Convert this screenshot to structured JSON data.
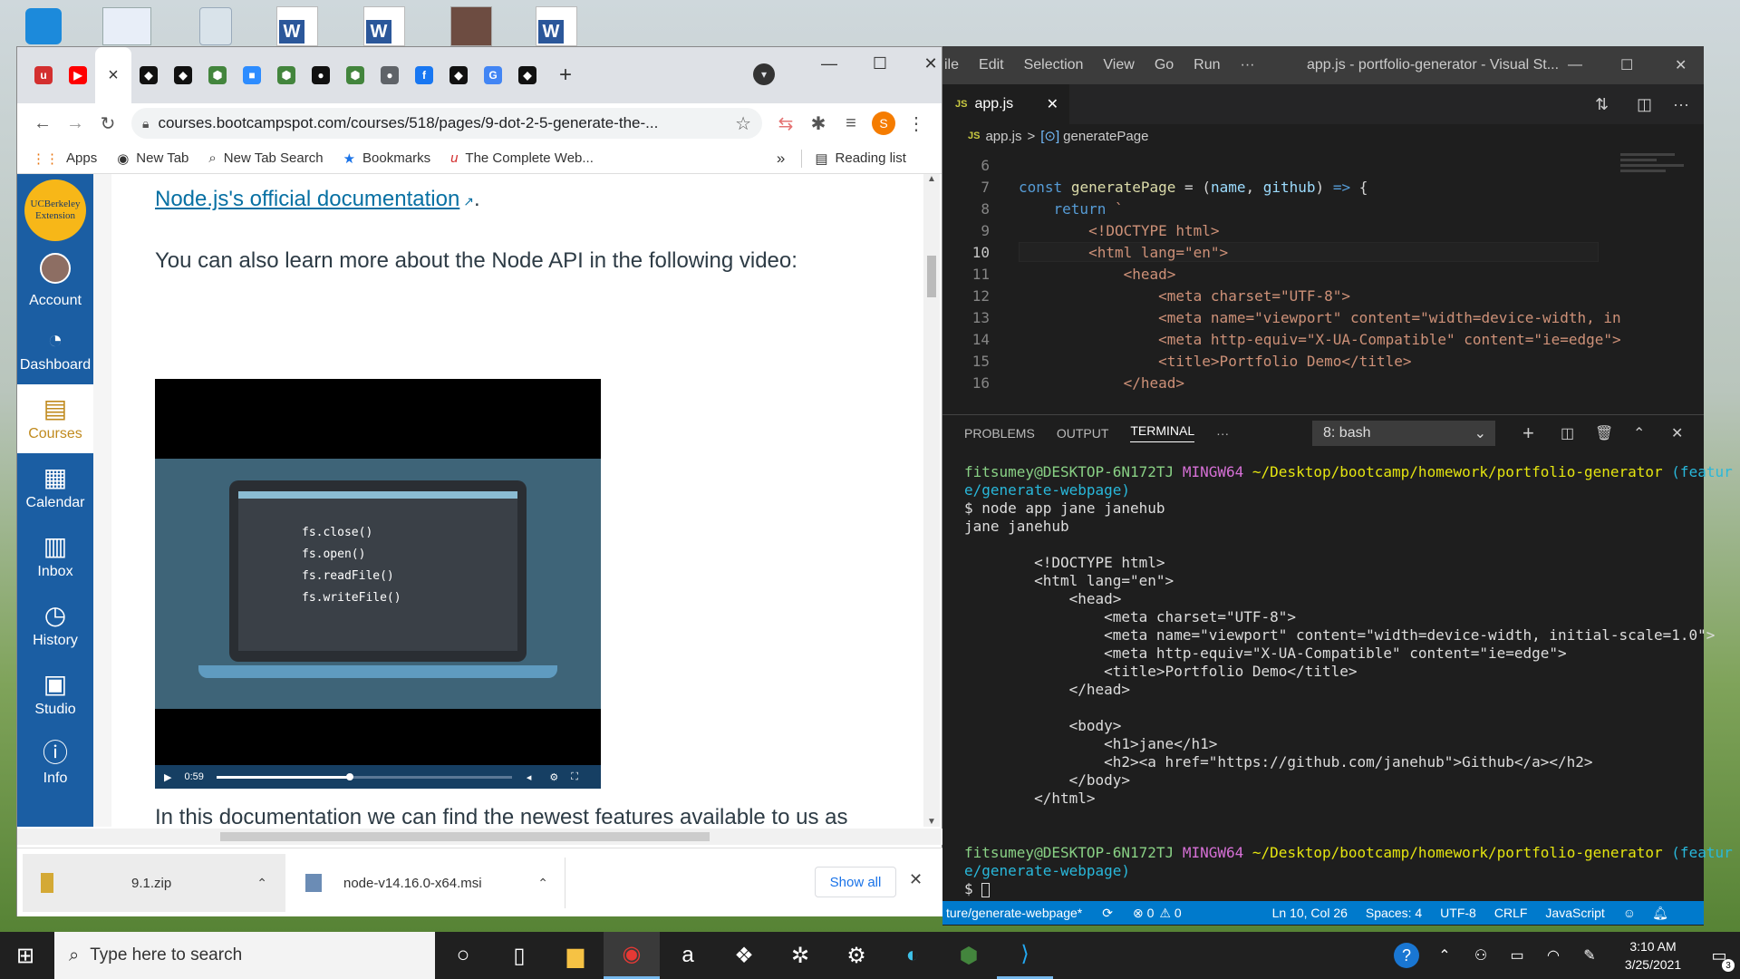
{
  "desktop": {
    "icons": [
      "app-icon",
      "document-icon",
      "recycle-bin-icon",
      "word-icon",
      "word-icon",
      "image-icon",
      "word-icon"
    ]
  },
  "chrome": {
    "tabs": [
      {
        "icon": "bootcamp-icon",
        "glyph": "u",
        "color": "#d32f2f"
      },
      {
        "icon": "youtube-icon",
        "glyph": "▶",
        "color": "#ff0000"
      },
      {
        "icon": "active-tab-icon",
        "glyph": "×",
        "color": "#555"
      },
      {
        "icon": "github-dark-icon",
        "glyph": "◆",
        "color": "#111"
      },
      {
        "icon": "github-dark-icon",
        "glyph": "◆",
        "color": "#111"
      },
      {
        "icon": "node-icon",
        "glyph": "⬢",
        "color": "#43853d"
      },
      {
        "icon": "zoom-icon",
        "glyph": "■",
        "color": "#2d8cff"
      },
      {
        "icon": "node-icon",
        "glyph": "⬢",
        "color": "#43853d"
      },
      {
        "icon": "github-icon",
        "glyph": "●",
        "color": "#111"
      },
      {
        "icon": "node-icon",
        "glyph": "⬢",
        "color": "#43853d"
      },
      {
        "icon": "globe-icon",
        "glyph": "●",
        "color": "#5f6368"
      },
      {
        "icon": "facebook-icon",
        "glyph": "f",
        "color": "#1877f2"
      },
      {
        "icon": "github-dark-icon",
        "glyph": "◆",
        "color": "#111"
      },
      {
        "icon": "google-icon",
        "glyph": "G",
        "color": "#4285f4"
      },
      {
        "icon": "github-dark-icon",
        "glyph": "◆",
        "color": "#111"
      }
    ],
    "new_tab": "+",
    "url": "courses.bootcampspot.com/courses/518/pages/9-dot-2-5-generate-the-...",
    "profile_initial": "S",
    "bookmarks": [
      {
        "icon": "apps-icon",
        "glyph": "⋮⋮",
        "label": "Apps"
      },
      {
        "icon": "globe-icon",
        "glyph": "◉",
        "label": "New Tab"
      },
      {
        "icon": "search-icon",
        "glyph": "⌕",
        "label": "New Tab Search"
      },
      {
        "icon": "star-icon",
        "glyph": "★",
        "label": "Bookmarks"
      },
      {
        "icon": "bootcamp-icon",
        "glyph": "u",
        "label": "The Complete Web..."
      }
    ],
    "overflow": "»",
    "reading_list": "Reading list"
  },
  "canvas_nav": {
    "logo_line1": "UCBerkeley",
    "logo_line2": "Extension",
    "items": [
      {
        "label": "Account",
        "icon": "avatar-icon",
        "glyph": ""
      },
      {
        "label": "Dashboard",
        "icon": "dashboard-icon",
        "glyph": "◔"
      },
      {
        "label": "Courses",
        "icon": "courses-icon",
        "glyph": "▤"
      },
      {
        "label": "Calendar",
        "icon": "calendar-icon",
        "glyph": "▦"
      },
      {
        "label": "Inbox",
        "icon": "inbox-icon",
        "glyph": "▥"
      },
      {
        "label": "History",
        "icon": "history-icon",
        "glyph": "◷"
      },
      {
        "label": "Studio",
        "icon": "studio-icon",
        "glyph": "▣"
      },
      {
        "label": "Info",
        "icon": "info-icon",
        "glyph": "ⓘ"
      }
    ]
  },
  "page": {
    "doc_link": "Node.js's official documentation",
    "doc_link_suffix": ".",
    "para1": "You can also learn more about the Node API in the following video:",
    "video_lines": [
      "fs.close()",
      "fs.open()",
      "fs.readFile()",
      "fs.writeFile()"
    ],
    "video_time": "0:59",
    "video_progress": 0.45,
    "para2": "In this documentation we can find the newest features available to us as"
  },
  "downloads": {
    "items": [
      {
        "icon": "zip-icon",
        "name": "9.1.zip"
      },
      {
        "icon": "installer-icon",
        "name": "node-v14.16.0-x64.msi"
      }
    ],
    "show_all": "Show all"
  },
  "vscode": {
    "menu": [
      "ile",
      "Edit",
      "Selection",
      "View",
      "Go",
      "Run",
      "···"
    ],
    "title": "app.js - portfolio-generator - Visual St...",
    "tab": "app.js",
    "tab_prefix": "JS",
    "breadcrumb_file": "app.js",
    "breadcrumb_symbol": "generatePage",
    "breadcrumb_sep": ">",
    "lines": [
      {
        "n": "6",
        "html": ""
      },
      {
        "n": "7",
        "html": "<span class='kw'>const</span> <span class='fn'>generatePage</span> <span class='pn'>= (</span><span class='vr'>name</span><span class='pn'>, </span><span class='vr'>github</span><span class='pn'>) </span><span class='kw'>=&gt;</span> <span class='pn'>{</span>"
      },
      {
        "n": "8",
        "html": "    <span class='kw'>return</span> <span class='str'>`</span>"
      },
      {
        "n": "9",
        "html": "        <span class='str'>&lt;!DOCTYPE html&gt;</span>"
      },
      {
        "n": "10",
        "html": "        <span class='str'>&lt;html lang=\"en\"&gt;</span>"
      },
      {
        "n": "11",
        "html": "            <span class='str'>&lt;head&gt;</span>"
      },
      {
        "n": "12",
        "html": "                <span class='str'>&lt;meta charset=\"UTF-8\"&gt;</span>"
      },
      {
        "n": "13",
        "html": "                <span class='str'>&lt;meta name=\"viewport\" content=\"width=device-width, in</span>"
      },
      {
        "n": "14",
        "html": "                <span class='str'>&lt;meta http-equiv=\"X-UA-Compatible\" content=\"ie=edge\"&gt;</span>"
      },
      {
        "n": "15",
        "html": "                <span class='str'>&lt;title&gt;Portfolio Demo&lt;/title&gt;</span>"
      },
      {
        "n": "16",
        "html": "            <span class='str'>&lt;/head&gt;</span>"
      }
    ],
    "panel_tabs": [
      "PROBLEMS",
      "OUTPUT",
      "TERMINAL",
      "···"
    ],
    "terminal_select": "8: bash",
    "terminal": [
      {
        "cls": "prompt",
        "user": "fitsumey@DESKTOP-6N172TJ",
        "env": "MINGW64",
        "path": "~/Desktop/bootcamp/homework/portfolio-generator",
        "branch": "(featur"
      },
      {
        "cls": "cy",
        "text": "e/generate-webpage)"
      },
      {
        "cls": "",
        "text": "$ node app jane janehub"
      },
      {
        "cls": "",
        "text": "jane janehub"
      },
      {
        "cls": "",
        "text": ""
      },
      {
        "cls": "",
        "text": "        <!DOCTYPE html>"
      },
      {
        "cls": "",
        "text": "        <html lang=\"en\">"
      },
      {
        "cls": "",
        "text": "            <head>"
      },
      {
        "cls": "",
        "text": "                <meta charset=\"UTF-8\">"
      },
      {
        "cls": "",
        "text": "                <meta name=\"viewport\" content=\"width=device-width, initial-scale=1.0\">"
      },
      {
        "cls": "",
        "text": "                <meta http-equiv=\"X-UA-Compatible\" content=\"ie=edge\">"
      },
      {
        "cls": "",
        "text": "                <title>Portfolio Demo</title>"
      },
      {
        "cls": "",
        "text": "            </head>"
      },
      {
        "cls": "",
        "text": ""
      },
      {
        "cls": "",
        "text": "            <body>"
      },
      {
        "cls": "",
        "text": "                <h1>jane</h1>"
      },
      {
        "cls": "",
        "text": "                <h2><a href=\"https://github.com/janehub\">Github</a></h2>"
      },
      {
        "cls": "",
        "text": "            </body>"
      },
      {
        "cls": "",
        "text": "        </html>"
      },
      {
        "cls": "",
        "text": ""
      },
      {
        "cls": "",
        "text": ""
      },
      {
        "cls": "prompt",
        "user": "fitsumey@DESKTOP-6N172TJ",
        "env": "MINGW64",
        "path": "~/Desktop/bootcamp/homework/portfolio-generator",
        "branch": "(featur"
      },
      {
        "cls": "cy",
        "text": "e/generate-webpage)"
      },
      {
        "cls": "",
        "text": "$ "
      }
    ],
    "status": {
      "branch": "ture/generate-webpage*",
      "errors": "⊗ 0",
      "warnings": "⚠ 0",
      "position": "Ln 10, Col 26",
      "spaces": "Spaces: 4",
      "encoding": "UTF-8",
      "eol": "CRLF",
      "language": "JavaScript"
    }
  },
  "taskbar": {
    "search_placeholder": "Type here to search",
    "time": "3:10 AM",
    "date": "3/25/2021",
    "notification_count": "3"
  }
}
